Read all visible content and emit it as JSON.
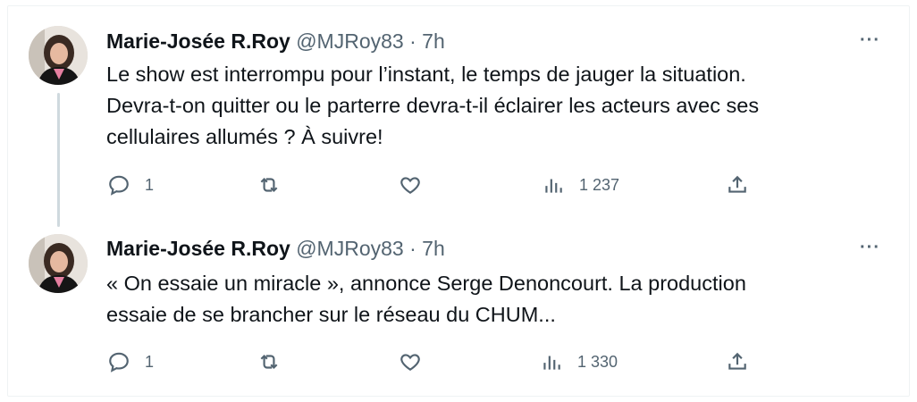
{
  "tweets": [
    {
      "author_name": "Marie-Josée R.Roy",
      "handle": "@MJRoy83",
      "separator": "·",
      "time": "7h",
      "text_lines": [
        "Le show est interrompu pour l’instant, le temps de jauger la situation.",
        "Devra-t-on quitter ou le parterre devra-t-il éclairer les acteurs avec ses",
        "cellulaires allumés ? À suivre!"
      ],
      "reply_count": "1",
      "views_count": "1 237",
      "more_label": "···"
    },
    {
      "author_name": "Marie-Josée R.Roy",
      "handle": "@MJRoy83",
      "separator": "·",
      "time": "7h",
      "text_lines": [
        "« On essaie un miracle », annonce Serge Denoncourt. La production",
        "essaie de se brancher sur le réseau du CHUM..."
      ],
      "reply_count": "1",
      "views_count": "1 330",
      "more_label": "···"
    }
  ],
  "icons": {
    "reply": "reply-icon",
    "retweet": "retweet-icon",
    "like": "heart-icon",
    "views": "views-icon",
    "share": "share-icon",
    "more": "more-icon"
  }
}
